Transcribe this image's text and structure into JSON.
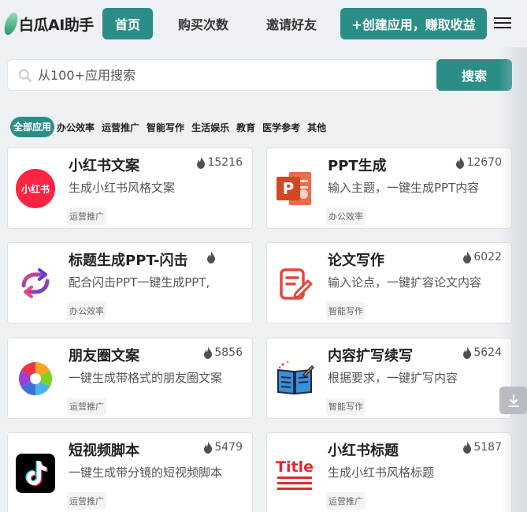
{
  "header": {
    "logo_text": "白瓜AI助手",
    "nav": {
      "home": "首页",
      "buy": "购买次数",
      "invite": "邀请好友",
      "create": "+创建应用，赚取收益"
    }
  },
  "search": {
    "placeholder": "从100+应用搜索",
    "button": "搜索"
  },
  "categories": [
    "全部应用",
    "办公效率",
    "运营推广",
    "智能写作",
    "生活娱乐",
    "教育",
    "医学参考",
    "其他"
  ],
  "cards": [
    {
      "title": "小红书文案",
      "hot": "15216",
      "desc": "生成小红书风格文案",
      "tag": "运营推广",
      "icon": "xiaohongshu-icon"
    },
    {
      "title": "PPT生成",
      "hot": "12670",
      "desc": "输入主题，一键生成PPT内容",
      "tag": "办公效率",
      "icon": "powerpoint-icon"
    },
    {
      "title": "标题生成PPT-闪击",
      "hot": "",
      "desc": "配合闪击PPT一键生成PPT,",
      "tag": "办公效率",
      "icon": "flash-ppt-icon"
    },
    {
      "title": "论文写作",
      "hot": "6022",
      "desc": "输入论点，一键扩容论文内容",
      "tag": "智能写作",
      "icon": "edit-document-icon"
    },
    {
      "title": "朋友圈文案",
      "hot": "5856",
      "desc": "一键生成带格式的朋友圈文案",
      "tag": "运营推广",
      "icon": "camera-aperture-icon"
    },
    {
      "title": "内容扩写续写",
      "hot": "5624",
      "desc": "根据要求，一键扩写内容",
      "tag": "智能写作",
      "icon": "open-book-icon"
    },
    {
      "title": "短视频脚本",
      "hot": "5479",
      "desc": "一键生成带分镜的短视频脚本",
      "tag": "运营推广",
      "icon": "tiktok-icon"
    },
    {
      "title": "小红书标题",
      "hot": "5187",
      "desc": "生成小红书风格标题",
      "tag": "运营推广",
      "icon": "title-icon"
    }
  ],
  "icon_labels": {
    "xiaohongshu": "小红书",
    "title": "Title"
  },
  "colors": {
    "primary": "#2a8e86",
    "xiaohongshu_red": "#ff2442",
    "ppt_orange": "#d24726",
    "title_red": "#e0282e"
  }
}
